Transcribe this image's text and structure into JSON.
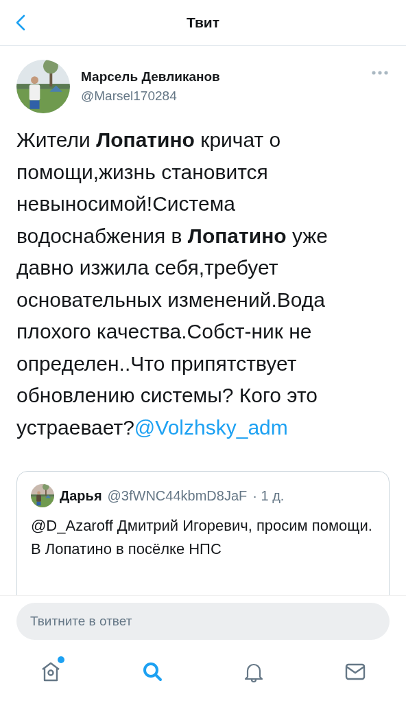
{
  "header": {
    "title": "Твит"
  },
  "tweet": {
    "author": "Марсель Девликанов",
    "handle": "@Marsel170284",
    "text": "Жители **Лопатино** кричат о помощи,жизнь становится невыносимой!Система водоснабжения в **Лопатино** уже давно изжила себя,требует основательных изменений.Вода плохого качества.Собст-ник не определен..Что припятствует обновлению системы? Кого это устраевает?",
    "mention": "@Volzhsky_adm"
  },
  "quoted_tweet": {
    "author": "Дарья",
    "handle": "@3fWNC44kbmD8JaF",
    "time": "· 1 д.",
    "text": "@D_Azaroff Дмитрий Игоревич, просим помощи. В Лопатино в посёлке НПС"
  },
  "reply": {
    "placeholder": "Твитните в ответ"
  },
  "tabs": [
    {
      "kind": "home",
      "selected": false,
      "badge": true
    },
    {
      "kind": "search",
      "selected": true,
      "badge": false
    },
    {
      "kind": "notifications",
      "selected": false,
      "badge": false
    },
    {
      "kind": "messages",
      "selected": false,
      "badge": false
    }
  ]
}
